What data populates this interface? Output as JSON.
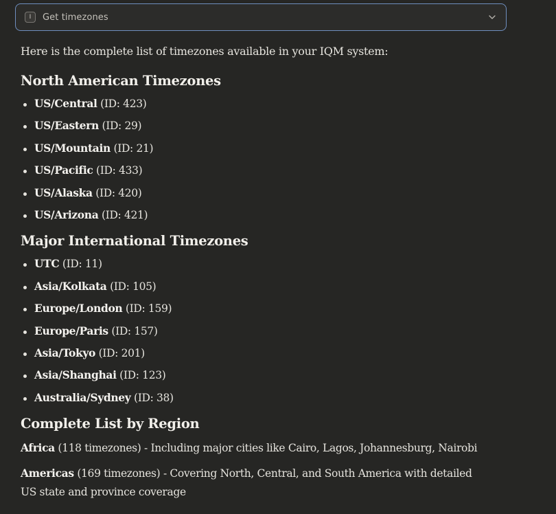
{
  "tool": {
    "badge": "I",
    "label": "Get timezones"
  },
  "intro": "Here is the complete list of timezones available in your IQM system:",
  "sections": [
    {
      "heading": "North American Timezones",
      "items": [
        {
          "name": "US/Central",
          "detail": " (ID: 423)"
        },
        {
          "name": "US/Eastern",
          "detail": " (ID: 29)"
        },
        {
          "name": "US/Mountain",
          "detail": " (ID: 21)"
        },
        {
          "name": "US/Pacific",
          "detail": " (ID: 433)"
        },
        {
          "name": "US/Alaska",
          "detail": " (ID: 420)"
        },
        {
          "name": "US/Arizona",
          "detail": " (ID: 421)"
        }
      ]
    },
    {
      "heading": "Major International Timezones",
      "items": [
        {
          "name": "UTC",
          "detail": " (ID: 11)"
        },
        {
          "name": "Asia/Kolkata",
          "detail": " (ID: 105)"
        },
        {
          "name": "Europe/London",
          "detail": " (ID: 159)"
        },
        {
          "name": "Europe/Paris",
          "detail": " (ID: 157)"
        },
        {
          "name": "Asia/Tokyo",
          "detail": " (ID: 201)"
        },
        {
          "name": "Asia/Shanghai",
          "detail": " (ID: 123)"
        },
        {
          "name": "Australia/Sydney",
          "detail": " (ID: 38)"
        }
      ]
    }
  ],
  "complete": {
    "heading": "Complete List by Region",
    "regions": [
      {
        "name": "Africa",
        "detail": " (118 timezones) - Including major cities like Cairo, Lagos, Johannesburg, Nairobi"
      },
      {
        "name": "Americas",
        "detail": " (169 timezones) - Covering North, Central, and South America with detailed US state and province coverage"
      }
    ]
  }
}
